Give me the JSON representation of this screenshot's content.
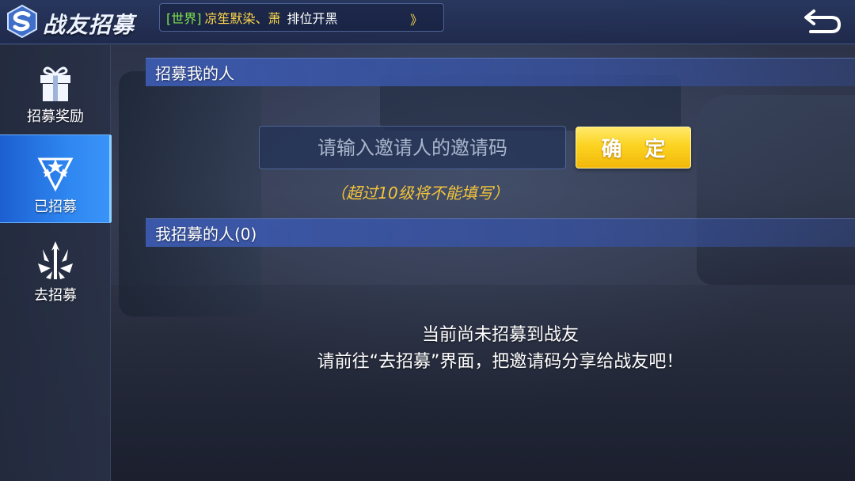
{
  "header": {
    "title": "战友招募",
    "logo_icon": "s-logo-icon",
    "back_icon": "return-arrow-icon"
  },
  "ticker": {
    "channel": "[世界]",
    "sender": "凉笙默染、萧",
    "message": "排位开黑",
    "more": "》"
  },
  "sidebar": {
    "items": [
      {
        "label": "招募奖励",
        "icon": "gift-icon",
        "active": false
      },
      {
        "label": "已招募",
        "icon": "stars-icon",
        "active": true
      },
      {
        "label": "去招募",
        "icon": "crest-icon",
        "active": false
      }
    ]
  },
  "recruiter_section": {
    "title": "招募我的人",
    "input_placeholder": "请输入邀请人的邀请码",
    "input_value": "",
    "confirm_label": "确 定",
    "hint": "（超过10级将不能填写）"
  },
  "recruits_section": {
    "title": "我招募的人(0)",
    "empty_line1": "当前尚未招募到战友",
    "empty_line2": "请前往“去招募”界面，把邀请码分享给战友吧！"
  },
  "colors": {
    "accent_blue": "#2e86f0",
    "confirm_yellow": "#fcd321",
    "hint_yellow": "#f5c53a",
    "channel_green": "#7fe34b"
  }
}
